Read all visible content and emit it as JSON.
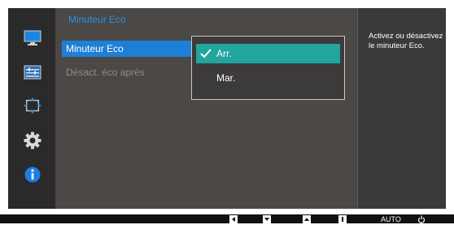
{
  "colors": {
    "accent_blue": "#1e7fd6",
    "title_blue": "#2a8fe0",
    "option_selected_teal": "#22a49f",
    "panel_bg": "#4b4846",
    "sidebar_bg": "#2a2a2a"
  },
  "sidebar": {
    "icons": [
      "picture-icon",
      "adjust-icon",
      "size-position-icon",
      "settings-gear-icon",
      "information-icon"
    ]
  },
  "panel": {
    "title": "Minuteur Eco",
    "items": [
      {
        "label": "Minuteur Eco",
        "state": "selected"
      },
      {
        "label": "Désact. éco après",
        "state": "disabled"
      }
    ]
  },
  "dropdown": {
    "options": [
      {
        "label": "Arr.",
        "selected": true
      },
      {
        "label": "Mar.",
        "selected": false
      }
    ]
  },
  "help": {
    "text": "Activez ou désactivez le minuteur Eco."
  },
  "bottom_bar": {
    "auto_label": "AUTO"
  }
}
